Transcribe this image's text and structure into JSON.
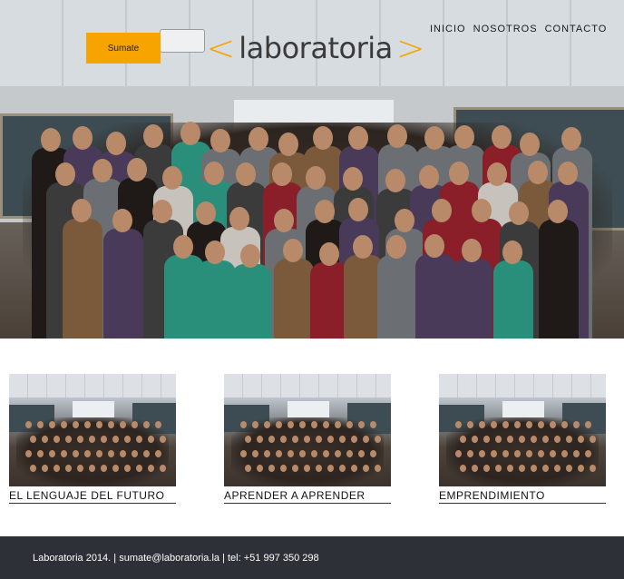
{
  "header": {
    "cta_label": "Sumate",
    "logo_text": "laboratoria",
    "logo_bracket_left": "<",
    "logo_bracket_right": ">",
    "nav": [
      {
        "label": "INICIO"
      },
      {
        "label": "NOSOTROS"
      },
      {
        "label": "CONTACTO"
      }
    ]
  },
  "cards": [
    {
      "title": "EL LENGUAJE DEL FUTURO"
    },
    {
      "title": "APRENDER A APRENDER"
    },
    {
      "title": "EMPRENDIMIENTO"
    }
  ],
  "footer": {
    "text": "Laboratoria 2014. | sumate@laboratoria.la | tel: +51 997 350 298"
  },
  "colors": {
    "accent": "#f7a400",
    "footer_bg": "#2e3037"
  },
  "images": {
    "hero": "group-photo-hero",
    "card_thumb": "group-photo-thumbnail"
  }
}
